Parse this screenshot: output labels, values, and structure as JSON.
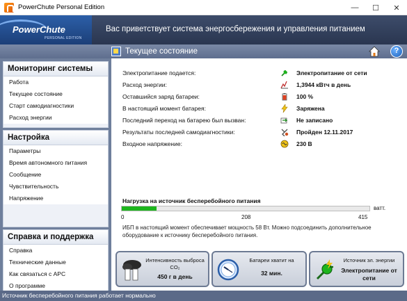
{
  "window": {
    "title": "PowerChute Personal Edition",
    "minimize": "—",
    "maximize": "☐",
    "close": "✕"
  },
  "banner": {
    "logo": "PowerChute",
    "logo_sub": "PERSONAL EDITION",
    "title": "Вас приветствует система энергосбережения и управления питанием"
  },
  "subheader": {
    "title": "Текущее состояние",
    "help": "?"
  },
  "sidebar": {
    "groups": [
      {
        "title": "Мониторинг системы",
        "items": [
          "Работа",
          "Текущее состояние",
          "Старт самодиагностики",
          "Расход энергии"
        ]
      },
      {
        "title": "Настройка",
        "items": [
          "Параметры",
          "Время автономного питания",
          "Сообщение",
          "Чувствительность",
          "Напряжение"
        ]
      },
      {
        "title": "Справка и поддержка",
        "items": [
          "Справка",
          "Технические данные",
          "Как связаться с APC",
          "О программе"
        ]
      }
    ]
  },
  "status_rows": [
    {
      "label": "Электропитание подается:",
      "value": "Электропитание от сети",
      "icon": "plug-icon"
    },
    {
      "label": "Расход энергии:",
      "value": "1,3944 кВтч в день",
      "icon": "energy-meter-icon"
    },
    {
      "label": "Оставшийся заряд батареи:",
      "value": "100 %",
      "icon": "battery-icon"
    },
    {
      "label": "В настоящий момент батарея:",
      "value": "Заряжена",
      "icon": "lightning-icon"
    },
    {
      "label": "Последний переход на батарею был вызван:",
      "value": "Не записано",
      "icon": "battery-switch-icon"
    },
    {
      "label": "Результаты последней самодиагностики:",
      "value": "Пройден 12.11.2017",
      "icon": "selftest-icon"
    },
    {
      "label": "Входное напряжение:",
      "value": "230 В",
      "icon": "voltage-icon"
    }
  ],
  "load": {
    "title": "Нагрузка на источник бесперебойного питания",
    "unit": "ватт.",
    "fraction": 0.14,
    "scale": [
      "0",
      "208",
      "415"
    ],
    "note": "ИБП в настоящий момент обеспечивает мощность 58 Вт. Можно подсоединить дополнительное оборудование к источнику бесперебойного питания."
  },
  "tiles": [
    {
      "label_line1": "Интенсивность выброса",
      "label_line2": "CO₂",
      "value": "450 г в день",
      "icon": "factory-icon"
    },
    {
      "label_line1": "Батареи хватит на",
      "label_line2": "",
      "value": "32 мин.",
      "icon": "clock-icon"
    },
    {
      "label_line1": "Источник эл. энергии",
      "label_line2": "",
      "value": "Электропитание от сети",
      "icon": "plug-icon"
    }
  ],
  "statusbar": {
    "text": "Источник бесперебойного питания работает нормально"
  },
  "colors": {
    "banner": "#2f3c58",
    "sidebar": "#6f7f9c",
    "load_fill": "#1db51d",
    "statusbar": "#5b6a88"
  }
}
